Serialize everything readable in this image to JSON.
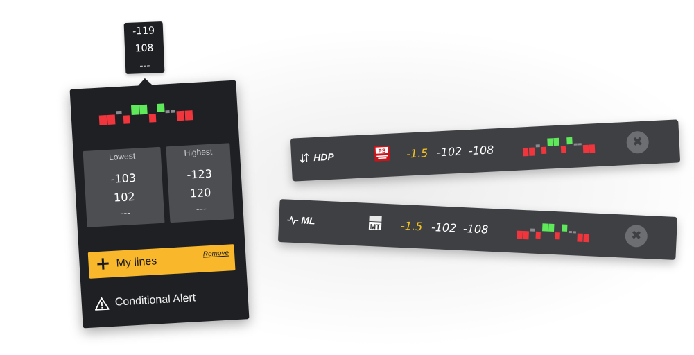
{
  "tooltip": {
    "lines": [
      "-119",
      "108",
      "---"
    ]
  },
  "popup": {
    "lowest": {
      "label": "Lowest",
      "values": [
        "-103",
        "102",
        "---"
      ]
    },
    "highest": {
      "label": "Highest",
      "values": [
        "-123",
        "120",
        "---"
      ]
    },
    "my_lines": {
      "label": "My lines",
      "remove_label": "Remove"
    },
    "conditional_alert": {
      "label": "Conditional Alert"
    }
  },
  "rows": [
    {
      "name": "HDP",
      "icon": "arrows-updown-icon",
      "logo": "ps-logo",
      "line": "-1.5",
      "odd1": "-102",
      "odd2": "-108"
    },
    {
      "name": "ML",
      "icon": "pulse-icon",
      "logo": "mt-logo",
      "line": "-1.5",
      "odd1": "-102",
      "odd2": "-108"
    }
  ],
  "colors": {
    "panel": "#1f2024",
    "row": "#3f4044",
    "accent": "#f9b82c",
    "up": "#5ee85a",
    "down": "#f0353d",
    "neutral": "#8a8a8f",
    "line_value": "#f4c21f"
  },
  "icons": {
    "plus": "+",
    "close": "✖"
  }
}
